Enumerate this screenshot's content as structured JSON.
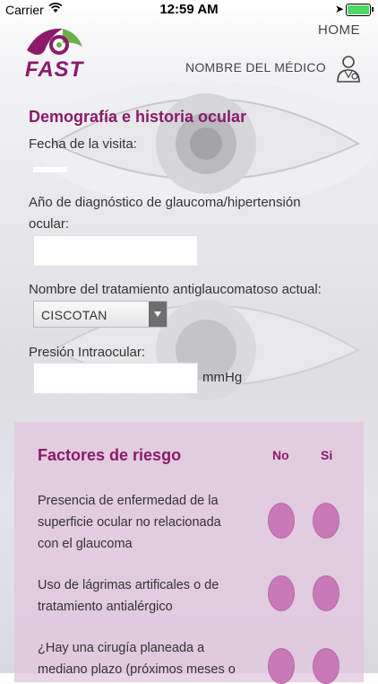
{
  "status_bar": {
    "carrier": "Carrier",
    "time": "12:59 AM"
  },
  "header": {
    "home_label": "HOME",
    "doctor_label": "NOMBRE DEL MÉDICO",
    "logo_text": "FAST"
  },
  "demographics": {
    "title": "Demografía e historia ocular",
    "visit_date_label": "Fecha de la visita:",
    "visit_date_value": "",
    "diagnosis_year_label": "Año de diagnóstico de glaucoma/hipertensión ocular:",
    "diagnosis_year_value": "",
    "treatment_label": "Nombre del tratamiento antiglaucomatoso actual:",
    "treatment_value": "CISCOTAN",
    "iop_label": "Presión Intraocular:",
    "iop_value": "",
    "iop_unit": "mmHg"
  },
  "risk_factors": {
    "title": "Factores de riesgo",
    "col_no": "No",
    "col_si": "Si",
    "items": [
      {
        "text": "Presencia de enfermedad de la superficie ocular no relacionada con el glaucoma"
      },
      {
        "text": "Uso de lágrimas artificales o de tratamiento antialérgico"
      },
      {
        "text": "¿Hay una cirugía planeada a mediano plazo (próximos meses o"
      }
    ]
  },
  "colors": {
    "accent": "#8b1a6b",
    "radio_fill": "#c77ab7",
    "panel": "#e1c4de"
  }
}
